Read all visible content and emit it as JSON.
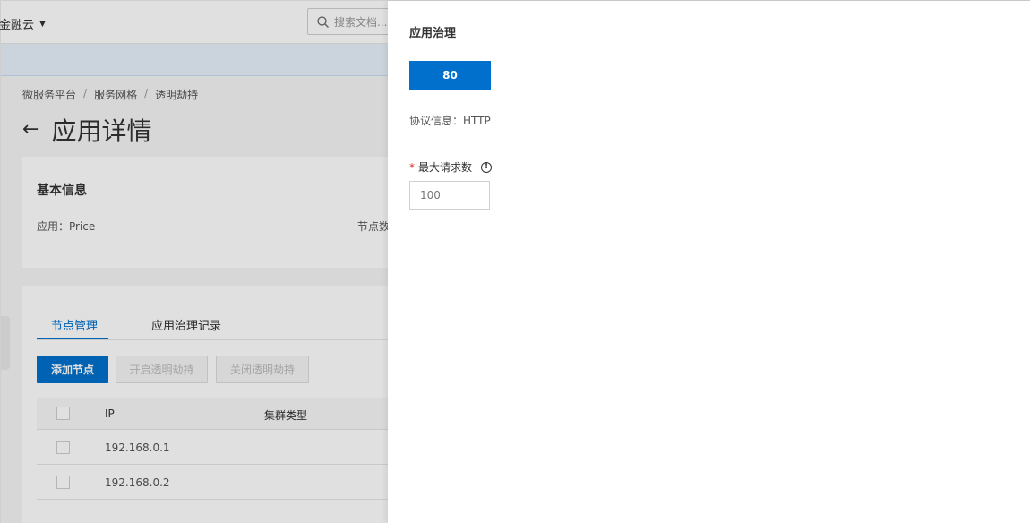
{
  "topbar": {
    "brand": "金融云",
    "search_placeholder": "搜索文档..."
  },
  "breadcrumb": [
    "微服务平台",
    "服务网格",
    "透明劫持"
  ],
  "page_title": "应用详情",
  "basic_info": {
    "title": "基本信息",
    "app_label": "应用：Price",
    "nodes_label": "节点数"
  },
  "tabs": [
    "节点管理",
    "应用治理记录"
  ],
  "buttons": {
    "add_node": "添加节点",
    "enable_hijack": "开启透明劫持",
    "disable_hijack": "关闭透明劫持"
  },
  "table": {
    "headers": [
      "IP",
      "集群类型"
    ],
    "rows": [
      {
        "ip": "192.168.0.1"
      },
      {
        "ip": "192.168.0.2"
      }
    ]
  },
  "drawer": {
    "title": "应用治理",
    "port_tab": "80",
    "protocol": "协议信息：HTTP",
    "max_requests_label": "最大请求数",
    "max_requests_value": "100"
  }
}
